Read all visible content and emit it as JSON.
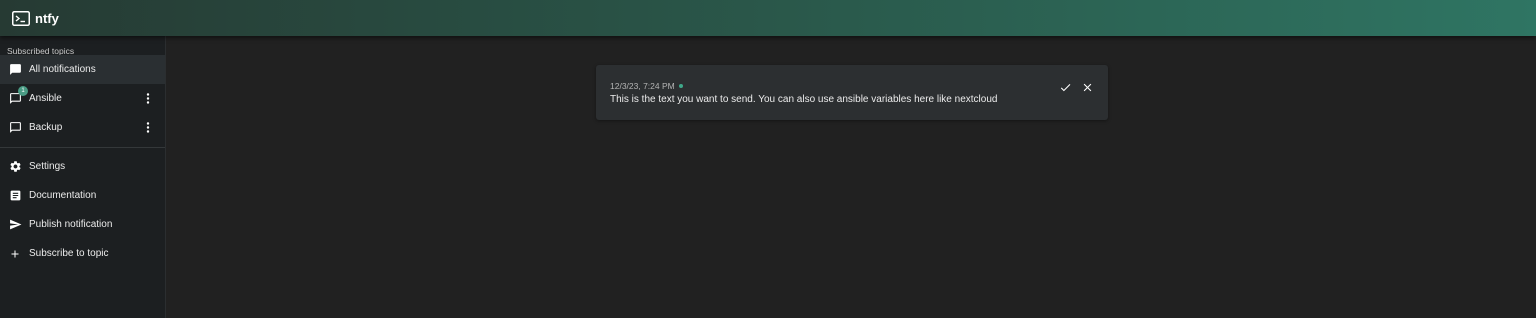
{
  "app": {
    "title": "ntfy",
    "logo_icon": "terminal-icon"
  },
  "colors": {
    "accent": "#338574",
    "badge": "#4a9c85",
    "new_dot": "#3fa88a"
  },
  "sidebar": {
    "heading": "Subscribed topics",
    "topics": [
      {
        "label": "All notifications",
        "icon": "message-filled-icon",
        "active": true
      },
      {
        "label": "Ansible",
        "icon": "message-outline-icon",
        "badge": "1",
        "menu_icon": "more-vert-icon"
      },
      {
        "label": "Backup",
        "icon": "message-outline-icon",
        "menu_icon": "more-vert-icon"
      }
    ],
    "actions": [
      {
        "label": "Settings",
        "icon": "gear-icon"
      },
      {
        "label": "Documentation",
        "icon": "document-icon"
      },
      {
        "label": "Publish notification",
        "icon": "send-icon"
      },
      {
        "label": "Subscribe to topic",
        "icon": "plus-icon"
      }
    ]
  },
  "notification": {
    "time": "12/3/23, 7:24 PM",
    "message": "This is the text you want to send. You can also use ansible variables here like nextcloud",
    "mark_read_icon": "check-icon",
    "close_icon": "close-icon"
  }
}
